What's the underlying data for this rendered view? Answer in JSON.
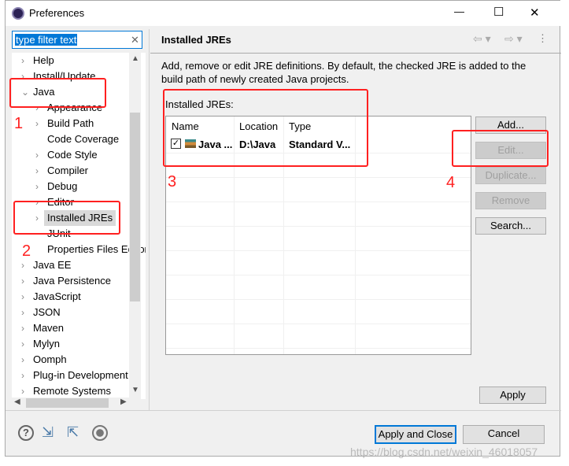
{
  "window": {
    "title": "Preferences",
    "minimize": "—",
    "maximize": "☐",
    "close": "✕"
  },
  "filter": {
    "value": "type filter text",
    "clear": "✕"
  },
  "tree": [
    {
      "label": "Help",
      "level": 0,
      "chev": "›"
    },
    {
      "label": "Install/Update",
      "level": 0,
      "chev": "›"
    },
    {
      "label": "Java",
      "level": 0,
      "chev": "⌄"
    },
    {
      "label": "Appearance",
      "level": 1,
      "chev": "›"
    },
    {
      "label": "Build Path",
      "level": 1,
      "chev": "›"
    },
    {
      "label": "Code Coverage",
      "level": 1,
      "chev": ""
    },
    {
      "label": "Code Style",
      "level": 1,
      "chev": "›"
    },
    {
      "label": "Compiler",
      "level": 1,
      "chev": "›"
    },
    {
      "label": "Debug",
      "level": 1,
      "chev": "›"
    },
    {
      "label": "Editor",
      "level": 1,
      "chev": "›"
    },
    {
      "label": "Installed JREs",
      "level": 1,
      "chev": "›",
      "selected": true
    },
    {
      "label": "JUnit",
      "level": 1,
      "chev": ""
    },
    {
      "label": "Properties Files Editor",
      "level": 1,
      "chev": ""
    },
    {
      "label": "Java EE",
      "level": 0,
      "chev": "›"
    },
    {
      "label": "Java Persistence",
      "level": 0,
      "chev": "›"
    },
    {
      "label": "JavaScript",
      "level": 0,
      "chev": "›"
    },
    {
      "label": "JSON",
      "level": 0,
      "chev": "›"
    },
    {
      "label": "Maven",
      "level": 0,
      "chev": "›"
    },
    {
      "label": "Mylyn",
      "level": 0,
      "chev": "›"
    },
    {
      "label": "Oomph",
      "level": 0,
      "chev": "›"
    },
    {
      "label": "Plug-in Development",
      "level": 0,
      "chev": "›"
    },
    {
      "label": "Remote Systems",
      "level": 0,
      "chev": "›"
    }
  ],
  "page": {
    "title": "Installed JREs",
    "description": "Add, remove or edit JRE definitions. By default, the checked JRE is added to the build path of newly created Java projects.",
    "table_label": "Installed JREs:",
    "columns": [
      "Name",
      "Location",
      "Type"
    ],
    "rows": [
      {
        "checked": true,
        "name": "Java ...",
        "location": "D:\\Java",
        "type": "Standard V..."
      }
    ],
    "buttons": {
      "add": "Add...",
      "edit": "Edit...",
      "duplicate": "Duplicate...",
      "remove": "Remove",
      "search": "Search..."
    },
    "apply": "Apply"
  },
  "footer": {
    "apply_close": "Apply and Close",
    "cancel": "Cancel"
  },
  "annotations": [
    "1",
    "2",
    "3",
    "4"
  ],
  "watermark": "https://blog.csdn.net/weixin_46018057",
  "colors": {
    "annotation": "#ff2020",
    "selection": "#0078d7"
  }
}
